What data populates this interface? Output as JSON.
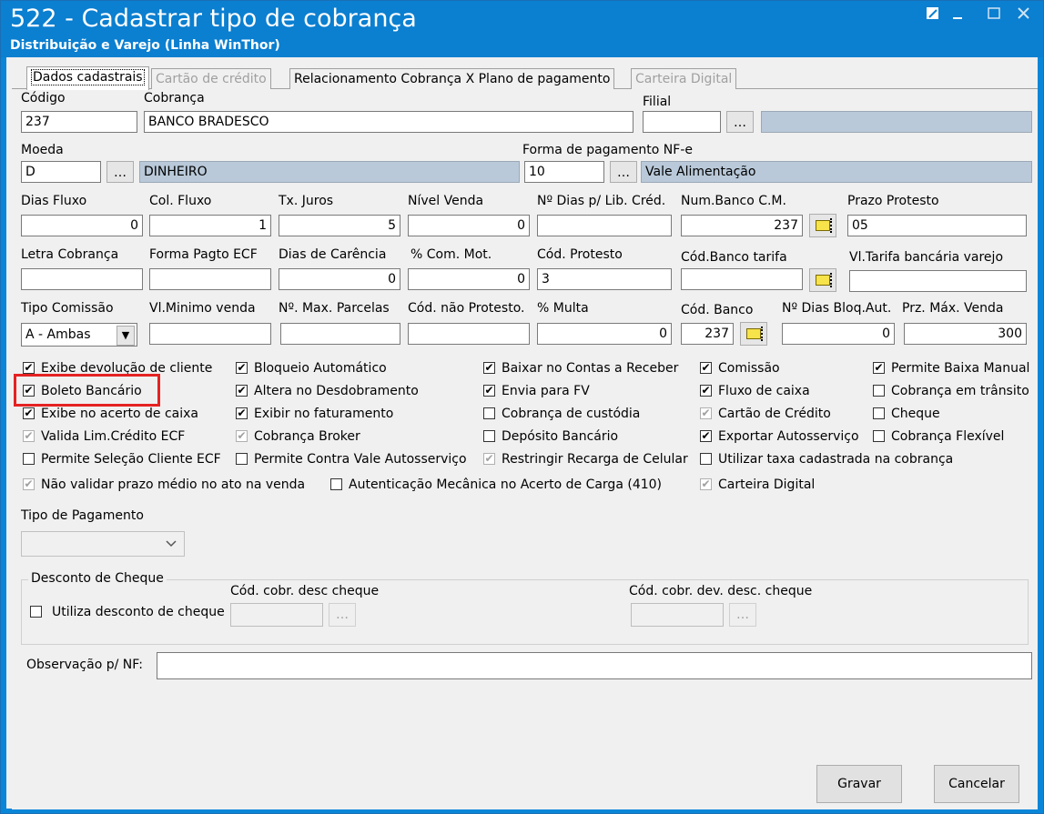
{
  "window": {
    "title": "522 - Cadastrar tipo de cobrança",
    "subtitle": "Distribuição e Varejo (Linha WinThor)",
    "controls": [
      "restore",
      "minimize",
      "maximize",
      "close"
    ]
  },
  "tabs": [
    "Dados cadastrais",
    "Cartão de crédito",
    "Relacionamento Cobrança X Plano de pagamento",
    "Carteira Digital"
  ],
  "fields": {
    "codigo": {
      "label": "Código",
      "value": "237"
    },
    "cobranca": {
      "label": "Cobrança",
      "value": "BANCO BRADESCO"
    },
    "filial": {
      "label": "Filial",
      "value": "",
      "desc": ""
    },
    "moeda": {
      "label": "Moeda",
      "value": "D",
      "desc": "DINHEIRO"
    },
    "forma_nfe": {
      "label": "Forma de pagamento NF-e",
      "value": "10",
      "desc": "Vale Alimentação"
    },
    "dias_fluxo": {
      "label": "Dias Fluxo",
      "value": "0"
    },
    "col_fluxo": {
      "label": "Col. Fluxo",
      "value": "1"
    },
    "tx_juros": {
      "label": "Tx. Juros",
      "value": "5"
    },
    "nivel_venda": {
      "label": "Nível Venda",
      "value": "0"
    },
    "dias_lib_cred": {
      "label": "Nº Dias p/ Lib. Créd.",
      "value": ""
    },
    "num_banco_cm": {
      "label": "Num.Banco C.M.",
      "value": "237"
    },
    "prazo_protesto": {
      "label": "Prazo Protesto",
      "value": "05"
    },
    "letra_cobranca": {
      "label": "Letra Cobrança",
      "value": ""
    },
    "forma_pagto_ecf": {
      "label": "Forma Pagto ECF",
      "value": ""
    },
    "dias_carencia": {
      "label": "Dias de Carência",
      "value": "0"
    },
    "com_mot": {
      "label": "% Com. Mot.",
      "value": "0"
    },
    "cod_protesto": {
      "label": "Cód. Protesto",
      "value": "3"
    },
    "cod_banco_tarifa": {
      "label": "Cód.Banco tarifa",
      "value": ""
    },
    "vl_tarifa": {
      "label": "Vl.Tarifa bancária varejo",
      "value": ""
    },
    "tipo_comissao": {
      "label": "Tipo Comissão",
      "value": "A - Ambas"
    },
    "vl_minimo": {
      "label": "Vl.Minimo venda",
      "value": ""
    },
    "max_parcelas": {
      "label": "Nº. Max. Parcelas",
      "value": ""
    },
    "cod_nao_protesto": {
      "label": "Cód. não Protesto.",
      "value": ""
    },
    "multa": {
      "label": "% Multa",
      "value": "0"
    },
    "cod_banco": {
      "label": "Cód. Banco",
      "value": "237"
    },
    "dias_bloq": {
      "label": "Nº Dias Bloq.Aut.",
      "value": "0"
    },
    "prz_max": {
      "label": "Prz. Máx. Venda",
      "value": "300"
    }
  },
  "checkboxes": [
    {
      "label": "Exibe devolução de cliente",
      "checked": true,
      "enabled": true
    },
    {
      "label": "Boleto Bancário",
      "checked": true,
      "enabled": true
    },
    {
      "label": "Exibe no acerto de caixa",
      "checked": true,
      "enabled": true
    },
    {
      "label": "Valida Lim.Crédito ECF",
      "checked": true,
      "enabled": false
    },
    {
      "label": "Permite Seleção Cliente ECF",
      "checked": false,
      "enabled": true
    },
    {
      "label": "Não validar prazo médio no ato na venda",
      "checked": true,
      "enabled": false
    },
    {
      "label": "Bloqueio Automático",
      "checked": true,
      "enabled": true
    },
    {
      "label": "Altera no Desdobramento",
      "checked": true,
      "enabled": true
    },
    {
      "label": "Exibir no faturamento",
      "checked": true,
      "enabled": true
    },
    {
      "label": "Cobrança Broker",
      "checked": true,
      "enabled": false
    },
    {
      "label": "Permite Contra Vale Autosserviço",
      "checked": false,
      "enabled": true
    },
    {
      "label": "Autenticação Mecânica no Acerto de Carga (410)",
      "checked": false,
      "enabled": true
    },
    {
      "label": "Baixar no Contas a Receber",
      "checked": true,
      "enabled": true
    },
    {
      "label": "Envia para FV",
      "checked": true,
      "enabled": true
    },
    {
      "label": "Cobrança de custódia",
      "checked": false,
      "enabled": true
    },
    {
      "label": "Depósito Bancário",
      "checked": false,
      "enabled": true
    },
    {
      "label": "Restringir Recarga de Celular",
      "checked": true,
      "enabled": false
    },
    {
      "label": "Comissão",
      "checked": true,
      "enabled": true
    },
    {
      "label": "Fluxo de caixa",
      "checked": true,
      "enabled": true
    },
    {
      "label": "Cartão de Crédito",
      "checked": true,
      "enabled": false
    },
    {
      "label": "Exportar Autosserviço",
      "checked": true,
      "enabled": true
    },
    {
      "label": "Utilizar taxa cadastrada na cobrança",
      "checked": false,
      "enabled": true
    },
    {
      "label": "Carteira Digital",
      "checked": true,
      "enabled": false
    },
    {
      "label": "Permite Baixa Manual",
      "checked": true,
      "enabled": true
    },
    {
      "label": "Cobrança em trânsito",
      "checked": false,
      "enabled": true
    },
    {
      "label": "Cheque",
      "checked": false,
      "enabled": true
    },
    {
      "label": "Cobrança Flexível",
      "checked": false,
      "enabled": true
    }
  ],
  "tipo_pagamento": {
    "label": "Tipo de Pagamento",
    "value": ""
  },
  "desconto_cheque": {
    "title": "Desconto de Cheque",
    "use_label": "Utiliza desconto de cheque",
    "cod_desc_label": "Cód. cobr. desc cheque",
    "cod_dev_label": "Cód. cobr. dev. desc. cheque"
  },
  "observacao": {
    "label": "Observação p/ NF:",
    "value": ""
  },
  "buttons": {
    "save": "Gravar",
    "cancel": "Cancelar"
  }
}
